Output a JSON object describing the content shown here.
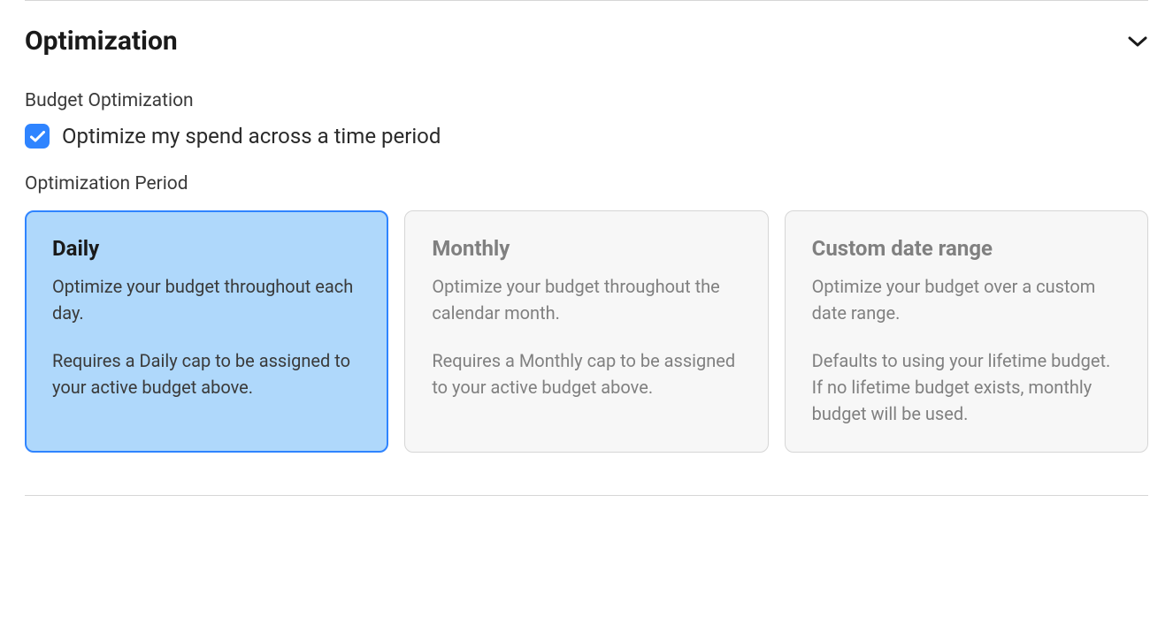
{
  "section": {
    "title": "Optimization"
  },
  "budget_optimization": {
    "label": "Budget Optimization",
    "checkbox_label": "Optimize my spend across a time period",
    "checked": true
  },
  "optimization_period": {
    "label": "Optimization Period",
    "selected_index": 0,
    "options": [
      {
        "title": "Daily",
        "description": "Optimize your budget throughout each day.",
        "requirement": "Requires a Daily cap to be assigned to your active budget above."
      },
      {
        "title": "Monthly",
        "description": "Optimize your budget throughout the calendar month.",
        "requirement": "Requires a Monthly cap to be assigned to your active budget above."
      },
      {
        "title": "Custom date range",
        "description": "Optimize your budget over a custom date range.",
        "requirement": "Defaults to using your lifetime budget. If no lifetime budget exists, monthly budget will be used."
      }
    ]
  }
}
